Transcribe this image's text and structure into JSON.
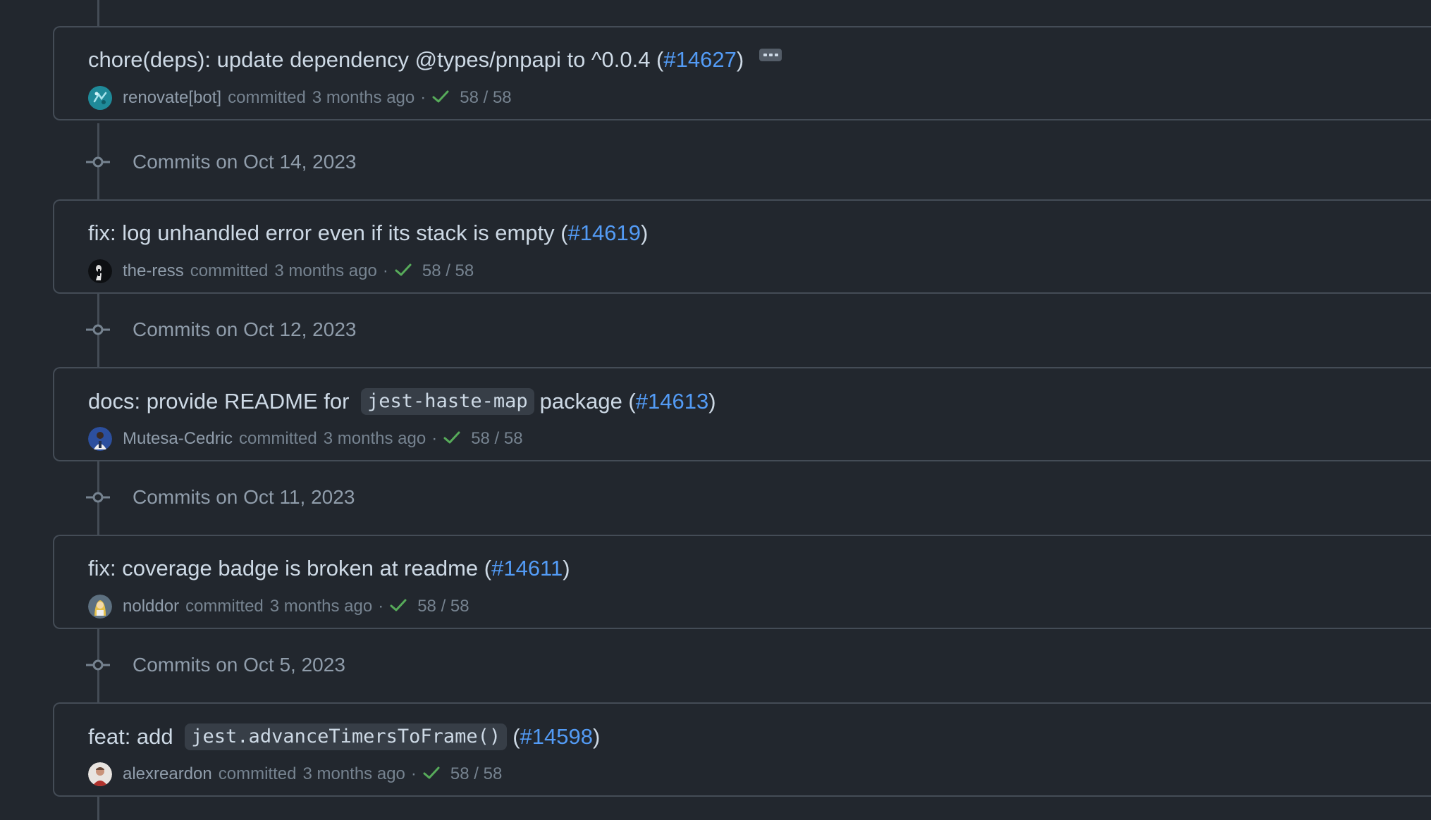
{
  "theme": {
    "background": "#22272e",
    "border": "#444c56",
    "link": "#539bf5",
    "success": "#57ab5a"
  },
  "commits": [
    {
      "title_parts": [
        {
          "type": "text",
          "value": "chore(deps): update dependency @types/pnpapi to ^0.0.4 ("
        },
        {
          "type": "link",
          "value": "#14627"
        },
        {
          "type": "text",
          "value": ")"
        }
      ],
      "author": "renovate[bot]",
      "committed_label": "committed",
      "time": "3 months ago",
      "checks": "58 / 58",
      "avatar_icon": "renovate-bot-avatar",
      "has_ellipsis": true
    },
    {
      "title_parts": [
        {
          "type": "text",
          "value": "fix: log unhandled error even if its stack is empty ("
        },
        {
          "type": "link",
          "value": "#14619"
        },
        {
          "type": "text",
          "value": ")"
        }
      ],
      "author": "the-ress",
      "committed_label": "committed",
      "time": "3 months ago",
      "checks": "58 / 58",
      "avatar_icon": "user-avatar"
    },
    {
      "title_parts": [
        {
          "type": "text",
          "value": "docs: provide README for "
        },
        {
          "type": "code",
          "value": "jest-haste-map"
        },
        {
          "type": "text",
          "value": "package ("
        },
        {
          "type": "link",
          "value": "#14613"
        },
        {
          "type": "text",
          "value": ")"
        }
      ],
      "author": "Mutesa-Cedric",
      "committed_label": "committed",
      "time": "3 months ago",
      "checks": "58 / 58",
      "avatar_icon": "user-avatar"
    },
    {
      "title_parts": [
        {
          "type": "text",
          "value": "fix: coverage badge is broken at readme ("
        },
        {
          "type": "link",
          "value": "#14611"
        },
        {
          "type": "text",
          "value": ")"
        }
      ],
      "author": "nolddor",
      "committed_label": "committed",
      "time": "3 months ago",
      "checks": "58 / 58",
      "avatar_icon": "user-avatar"
    },
    {
      "title_parts": [
        {
          "type": "text",
          "value": "feat: add "
        },
        {
          "type": "code",
          "value": "jest.advanceTimersToFrame()"
        },
        {
          "type": "text",
          "value": "("
        },
        {
          "type": "link",
          "value": "#14598"
        },
        {
          "type": "text",
          "value": ")"
        }
      ],
      "author": "alexreardon",
      "committed_label": "committed",
      "time": "3 months ago",
      "checks": "58 / 58",
      "avatar_icon": "user-avatar"
    }
  ],
  "date_groups": [
    {
      "label": "Commits on Oct 14, 2023"
    },
    {
      "label": "Commits on Oct 12, 2023"
    },
    {
      "label": "Commits on Oct 11, 2023"
    },
    {
      "label": "Commits on Oct 5, 2023"
    }
  ]
}
